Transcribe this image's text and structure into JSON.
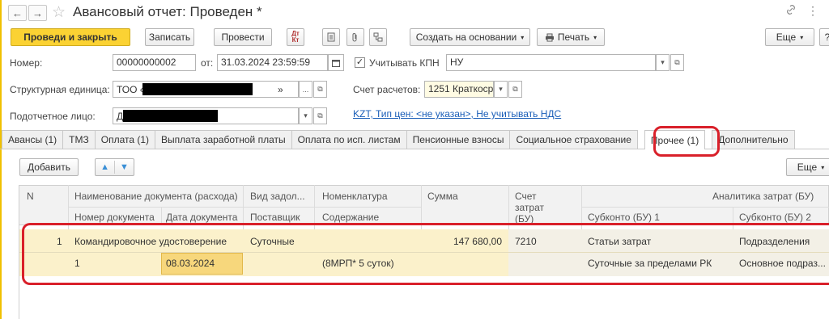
{
  "window": {
    "title": "Авансовый отчет: Проведен *",
    "back": "←",
    "forward": "→",
    "star": "☆",
    "link_icon": "🔗",
    "more_icon": "⋮"
  },
  "toolbar": {
    "post_close": "Проведи и закрыть",
    "save": "Записать",
    "post": "Провести",
    "create_based": "Создать на основании",
    "print": "Печать",
    "more": "Еще",
    "help": "?"
  },
  "form": {
    "number_label": "Номер:",
    "number_value": "00000000002",
    "date_label": "от:",
    "date_value": "31.03.2024 23:59:59",
    "kpn_label": "Учитывать КПН",
    "kpn_value": "НУ",
    "struct_label": "Структурная единица:",
    "struct_prefix": "ТОО «",
    "struct_suffix": "»",
    "account_label": "Счет расчетов:",
    "account_value": "1251 Краткосро",
    "person_label": "Подотчетное лицо:",
    "person_prefix": "Д",
    "price_link": "KZT, Тип цен: <не указан>, Не учитывать НДС"
  },
  "tabs": [
    "Авансы (1)",
    "ТМЗ",
    "Оплата (1)",
    "Выплата заработной платы",
    "Оплата по исп. листам",
    "Пенсионные взносы",
    "Социальное страхование",
    "Прочее (1)",
    "Дополнительно"
  ],
  "table_toolbar": {
    "add": "Добавить",
    "up": "🡅",
    "down": "🡇",
    "more": "Еще"
  },
  "table": {
    "headers": {
      "n": "N",
      "doc_name": "Наименование документа (расхода)",
      "debt_type": "Вид задол...",
      "nomenclature": "Номенклатура",
      "sum": "Сумма",
      "cost_account": "Счет затрат (БУ)",
      "analytics": "Аналитика затрат (БУ)",
      "doc_number": "Номер документа",
      "doc_date": "Дата документа",
      "supplier": "Поставщик",
      "content": "Содержание",
      "subconto1": "Субконто (БУ) 1",
      "subconto2": "Субконто (БУ) 2"
    },
    "row": {
      "n": "1",
      "doc_name": "Командировочное удостоверение",
      "debt_type": "Суточные",
      "sum": "147 680,00",
      "cost_account": "7210",
      "subconto1": "Статьи затрат",
      "subconto2": "Подразделения",
      "doc_number": "1",
      "doc_date": "08.03.2024",
      "content": "(8МРП* 5 суток)",
      "subconto1b": "Суточные за пределами РК",
      "subconto2b": "Основное подраз..."
    }
  }
}
